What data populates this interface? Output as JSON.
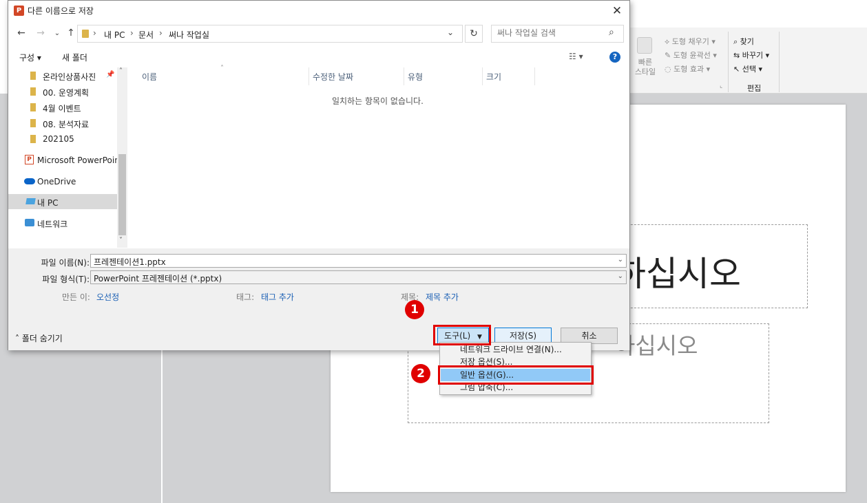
{
  "ppt": {
    "ribbon": {
      "quick_style": "빠른\n스타일",
      "shape_fill": "도형 채우기",
      "shape_outline": "도형 윤곽선",
      "shape_effects": "도형 효과",
      "find": "찾기",
      "replace": "바꾸기",
      "select": "선택",
      "group_edit": "편집"
    },
    "slide": {
      "title_placeholder": "하십시오",
      "subtitle_placeholder": "하십시오"
    }
  },
  "dialog": {
    "title": "다른 이름으로 저장",
    "app_icon_letter": "P",
    "close_glyph": "✕",
    "breadcrumb": [
      "내 PC",
      "문서",
      "써나 작업실"
    ],
    "search_placeholder": "써나 작업실 검색",
    "commands": {
      "organize": "구성 ▾",
      "new_folder": "새 폴더"
    },
    "nav_items": [
      {
        "label": "온라인상품사진",
        "icon": "folder-icon"
      },
      {
        "label": "00. 운영계획",
        "icon": "folder-icon"
      },
      {
        "label": "4월 이벤트",
        "icon": "folder-icon"
      },
      {
        "label": "08. 분석자료",
        "icon": "folder-icon"
      },
      {
        "label": "202105",
        "icon": "folder-icon"
      },
      {
        "label": "Microsoft PowerPoint",
        "icon": "powerpoint-icon"
      },
      {
        "label": "OneDrive",
        "icon": "onedrive-icon"
      },
      {
        "label": "내 PC",
        "icon": "pc-icon"
      },
      {
        "label": "네트워크",
        "icon": "network-icon"
      }
    ],
    "columns": [
      "이름",
      "수정한 날짜",
      "유형",
      "크기"
    ],
    "empty_message": "일치하는 항목이 없습니다.",
    "file_name_label": "파일 이름(N):",
    "file_name_value": "프레젠테이션1.pptx",
    "file_type_label": "파일 형식(T):",
    "file_type_value": "PowerPoint 프레젠테이션 (*.pptx)",
    "author_label": "만든 이:",
    "author_value": "오선정",
    "tags_label": "태그:",
    "tags_value": "태그 추가",
    "title_label": "제목:",
    "title_value": "제목 추가",
    "hide_folders": "폴더 숨기기",
    "buttons": {
      "tools": "도구(L)",
      "save": "저장(S)",
      "cancel": "취소"
    }
  },
  "tools_menu": [
    "네트워크 드라이브 연결(N)...",
    "저장 옵션(S)...",
    "일반 옵션(G)...",
    "그림 압축(C)..."
  ],
  "annotations": {
    "step1": "1",
    "step2": "2"
  },
  "colors": {
    "highlight": "#e00000",
    "accent": "#0078d7"
  }
}
